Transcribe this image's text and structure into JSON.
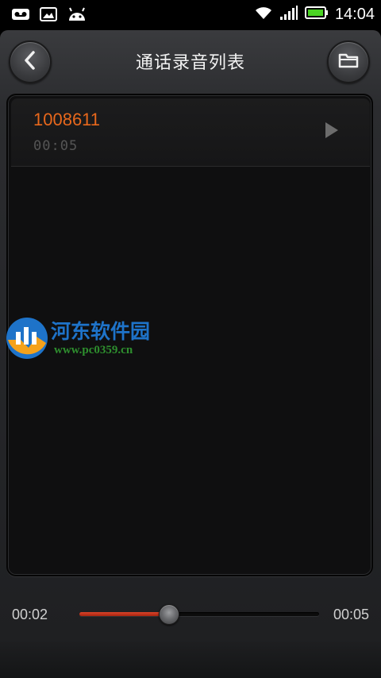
{
  "status_bar": {
    "time": "14:04",
    "icons": [
      "voicemail-icon",
      "image-icon",
      "android-icon",
      "wifi-icon",
      "signal-icon",
      "battery-icon"
    ]
  },
  "header": {
    "title": "通话录音列表",
    "back_icon": "chevron-left-icon",
    "folder_icon": "folder-icon"
  },
  "recordings": [
    {
      "number": "1008611",
      "duration": "00:05",
      "play_icon": "play-icon"
    }
  ],
  "player": {
    "current_time": "00:02",
    "total_time": "00:05",
    "progress": 0.375
  },
  "watermark": {
    "name": "河东软件园",
    "url": "www.pc0359.cn"
  },
  "colors": {
    "accent": "#e8681c",
    "progress": "#d8442a",
    "watermark_blue": "#1e73c9",
    "watermark_green": "#2e8f2e"
  }
}
